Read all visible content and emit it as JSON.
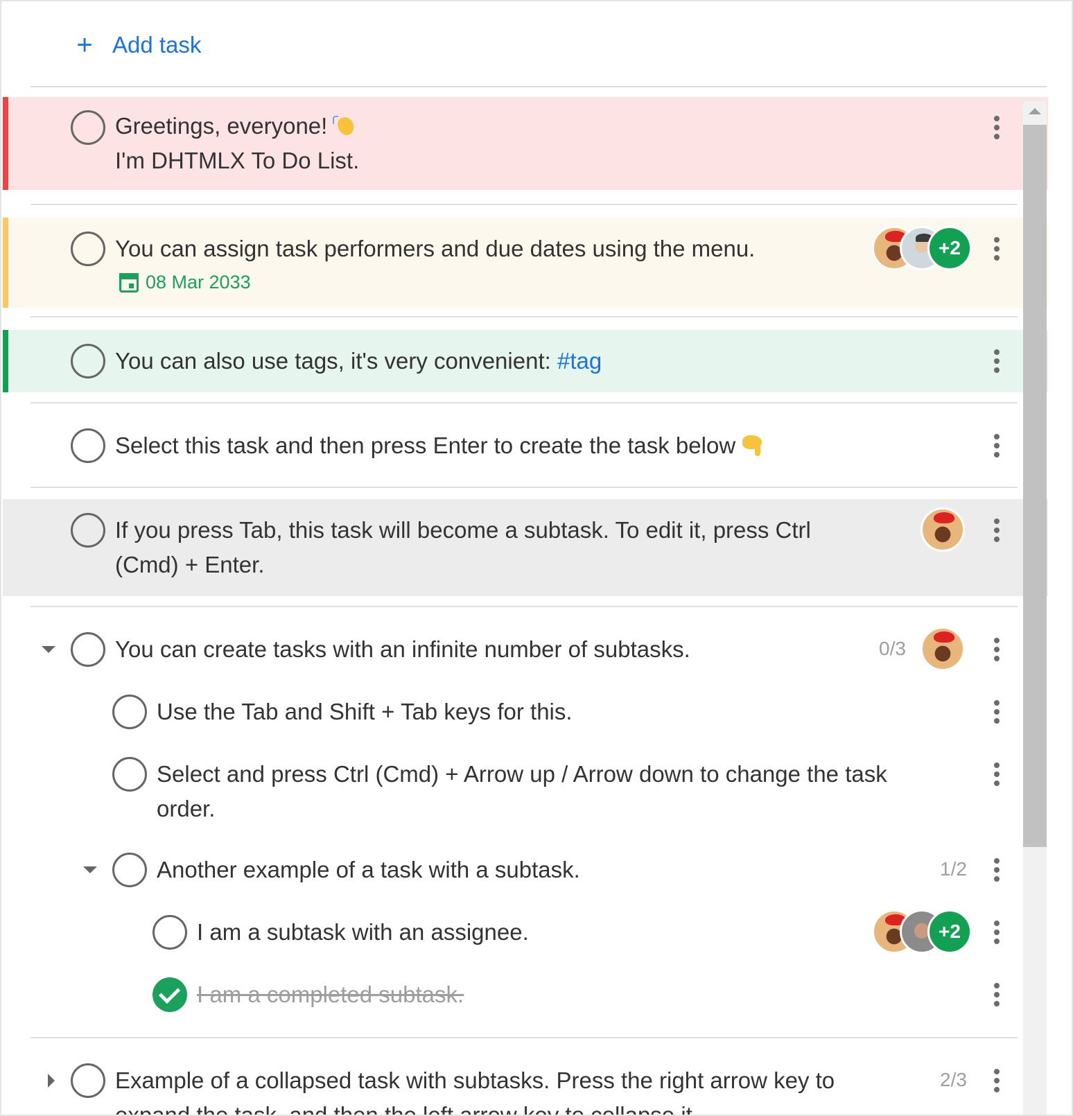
{
  "add_task": {
    "icon": "plus-icon",
    "label": "Add task"
  },
  "colors": {
    "accent_blue": "#1a73e8",
    "success_green": "#1aa15b",
    "priority_high_bg": "#fde3e3",
    "priority_high_bar": "#ef4444",
    "priority_mid_bg": "#fdf8ee",
    "priority_mid_bar": "#fdc763",
    "priority_low_bg": "#e6f6ee",
    "priority_low_bar": "#12a153",
    "selected_bg": "#ececec"
  },
  "tasks": [
    {
      "line1": "Greetings, everyone!",
      "emoji": "waving-hand",
      "line2": "I'm DHTMLX To Do List."
    },
    {
      "text": "You can assign task performers and due dates using the menu.",
      "due_date": "08 Mar 2033",
      "avatars_extra": "+2"
    },
    {
      "text_prefix": "You can also use tags, it's very convenient:",
      "tag": "#tag"
    },
    {
      "text": "Select this task and then press Enter to create the task below",
      "emoji": "pointing-down"
    },
    {
      "line1": "If you press Tab, this task will become a subtask. To edit it, press Ctrl",
      "line2": "(Cmd) + Enter."
    },
    {
      "text": "You can create tasks with an infinite number of subtasks.",
      "counter": "0/3"
    },
    {
      "text": "Use the Tab and Shift + Tab keys for this."
    },
    {
      "line1": "Select and press Ctrl (Cmd) + Arrow up / Arrow down to change the task",
      "line2": "order."
    },
    {
      "text": "Another example of a task with a subtask.",
      "counter": "1/2"
    },
    {
      "text": "I am a subtask with an assignee.",
      "avatars_extra": "+2"
    },
    {
      "text": "I am a completed subtask."
    },
    {
      "line1": "Example of a collapsed task with subtasks. Press the right arrow key to",
      "line2": "expand the task, and then the left arrow key to collapse it.",
      "counter": "2/3"
    }
  ]
}
